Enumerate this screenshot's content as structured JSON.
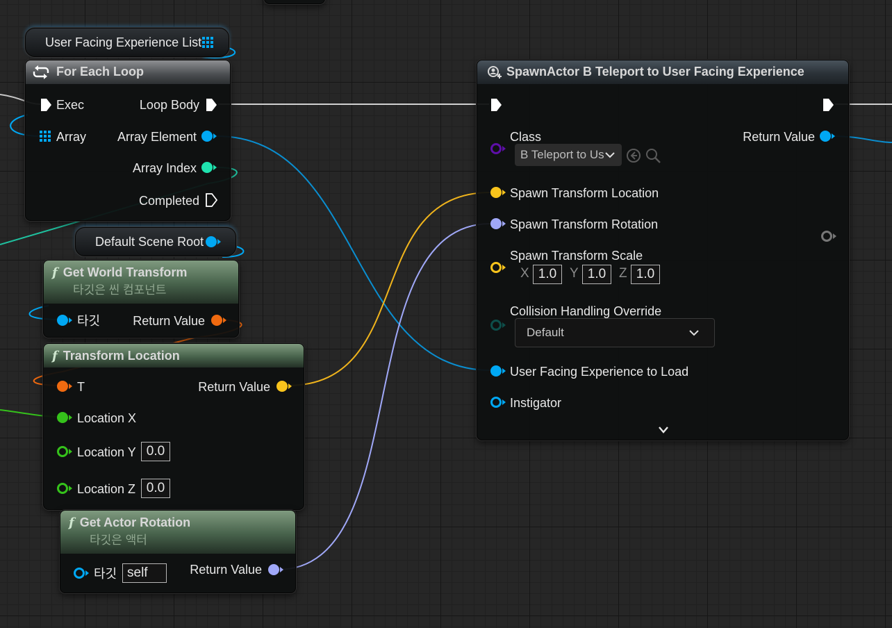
{
  "variables": {
    "user_facing_list": {
      "label": "User Facing Experience List",
      "icon": "array-grid-icon"
    },
    "default_scene_root": {
      "label": "Default Scene Root",
      "icon": "object-pin-icon"
    }
  },
  "for_each_loop": {
    "title": "For Each Loop",
    "icon": "loop-icon",
    "inputs": [
      "Exec",
      "Array"
    ],
    "outputs": [
      "Loop Body",
      "Array Element",
      "Array Index",
      "Completed"
    ]
  },
  "get_world_transform": {
    "title": "Get World Transform",
    "subtitle": "타깃은 씬 컴포넌트",
    "target_label": "타깃",
    "return_label": "Return Value"
  },
  "transform_location": {
    "title": "Transform Location",
    "inputs": {
      "t": "T",
      "x": "Location X",
      "y": "Location Y",
      "z": "Location Z"
    },
    "y_value": "0.0",
    "z_value": "0.0",
    "return_label": "Return Value"
  },
  "get_actor_rotation": {
    "title": "Get Actor Rotation",
    "subtitle": "타깃은 액터",
    "target_label": "타깃",
    "target_value": "self",
    "return_label": "Return Value"
  },
  "spawn_actor": {
    "title": "SpawnActor B Teleport to User Facing Experience",
    "class_label": "Class",
    "class_value": "B Teleport to Us",
    "return_label": "Return Value",
    "location_label": "Spawn Transform Location",
    "rotation_label": "Spawn Transform Rotation",
    "scale_label": "Spawn Transform Scale",
    "scale": {
      "x_label": "X",
      "y_label": "Y",
      "z_label": "Z",
      "x": "1.0",
      "y": "1.0",
      "z": "1.0"
    },
    "collision_label": "Collision Handling Override",
    "collision_value": "Default",
    "experience_label": "User Facing Experience to Load",
    "instigator_label": "Instigator"
  },
  "colors": {
    "object": "#00a8f4",
    "vector": "#f9c41c",
    "rotator": "#a0a8f8",
    "transform": "#f06a10",
    "float": "#35c21b",
    "integer": "#1fe3af",
    "class": "#5d0fa8"
  }
}
